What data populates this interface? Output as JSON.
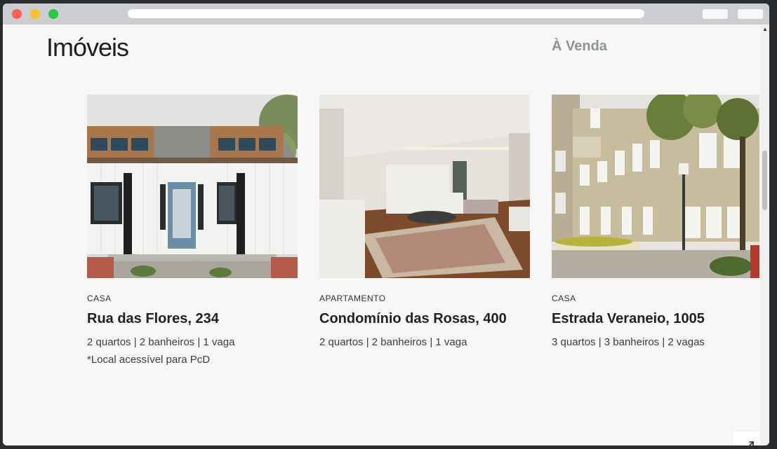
{
  "page": {
    "title": "Imóveis",
    "sale_link": "À Venda"
  },
  "properties": [
    {
      "type": "CASA",
      "name": "Rua das Flores, 234",
      "details": "2 quartos | 2 banheiros | 1 vaga",
      "note": "*Local acessível para PcD"
    },
    {
      "type": "APARTAMENTO",
      "name": "Condomínio das Rosas, 400",
      "details": "2 quartos | 2 banheiros | 1 vaga"
    },
    {
      "type": "CASA",
      "name": "Estrada Veraneio, 1005",
      "details": "3 quartos | 3 banheiros | 2 vagas"
    }
  ],
  "icons": {
    "fullscreen": "expand-icon",
    "scroll_up": "scroll-up-arrow-icon"
  },
  "colors": {
    "background": "#f6f7f6",
    "title": "#1d1f20",
    "sale_link": "#8b9691"
  }
}
